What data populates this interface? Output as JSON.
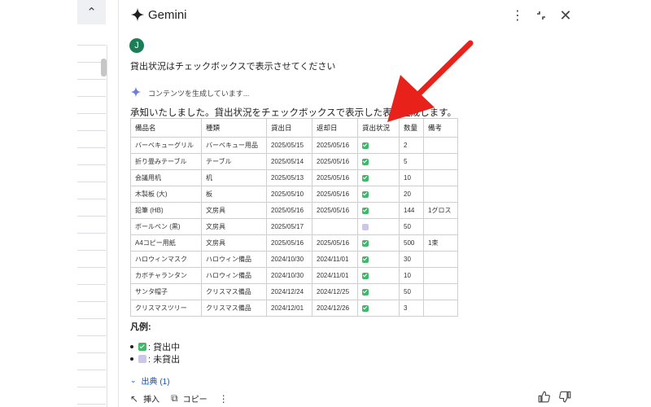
{
  "sheet": {
    "collapse_icon": "chevron-up-icon"
  },
  "header": {
    "title": "Gemini",
    "logo_icon": "gemini-spark-icon"
  },
  "user": {
    "avatar_initial": "J",
    "avatar_color": "#1a7f56",
    "message": "貸出状況はチェックボックスで表示させてください"
  },
  "status": {
    "text": "コンテンツを生成しています..."
  },
  "response": {
    "intro": "承知いたしました。貸出状況をチェックボックスで表示した表を生成します。",
    "columns": [
      "備品名",
      "種類",
      "貸出日",
      "返却日",
      "貸出状況",
      "数量",
      "備考"
    ],
    "rows": [
      [
        "バーベキューグリル",
        "バーベキュー用品",
        "2025/05/15",
        "2025/05/16",
        true,
        "2",
        ""
      ],
      [
        "折り畳みテーブル",
        "テーブル",
        "2025/05/14",
        "2025/05/16",
        true,
        "5",
        ""
      ],
      [
        "会議用机",
        "机",
        "2025/05/13",
        "2025/05/16",
        true,
        "10",
        ""
      ],
      [
        "木製板 (大)",
        "板",
        "2025/05/10",
        "2025/05/16",
        true,
        "20",
        ""
      ],
      [
        "鉛筆 (HB)",
        "文房具",
        "2025/05/16",
        "2025/05/16",
        true,
        "144",
        "1グロス"
      ],
      [
        "ボールペン (黒)",
        "文房具",
        "2025/05/17",
        "",
        false,
        "50",
        ""
      ],
      [
        "A4コピー用紙",
        "文房具",
        "2025/05/16",
        "2025/05/16",
        true,
        "500",
        "1束"
      ],
      [
        "ハロウィンマスク",
        "ハロウィン備品",
        "2024/10/30",
        "2024/11/01",
        true,
        "30",
        ""
      ],
      [
        "カボチャランタン",
        "ハロウィン備品",
        "2024/10/30",
        "2024/11/01",
        true,
        "10",
        ""
      ],
      [
        "サンタ帽子",
        "クリスマス備品",
        "2024/12/24",
        "2024/12/25",
        true,
        "50",
        ""
      ],
      [
        "クリスマスツリー",
        "クリスマス備品",
        "2024/12/01",
        "2024/12/26",
        true,
        "3",
        ""
      ]
    ],
    "legend_title": "凡例:",
    "legend": [
      {
        "state": "checked",
        "label": ": 貸出中"
      },
      {
        "state": "unchecked",
        "label": ": 未貸出"
      }
    ],
    "sources_label": "出典 (1)"
  },
  "footer": {
    "insert_label": "挿入",
    "copy_label": "コピー"
  },
  "colors": {
    "checked": "#40b86a",
    "unchecked": "#cdc6e8",
    "link": "#0b57d0",
    "arrow": "#e8221b"
  }
}
